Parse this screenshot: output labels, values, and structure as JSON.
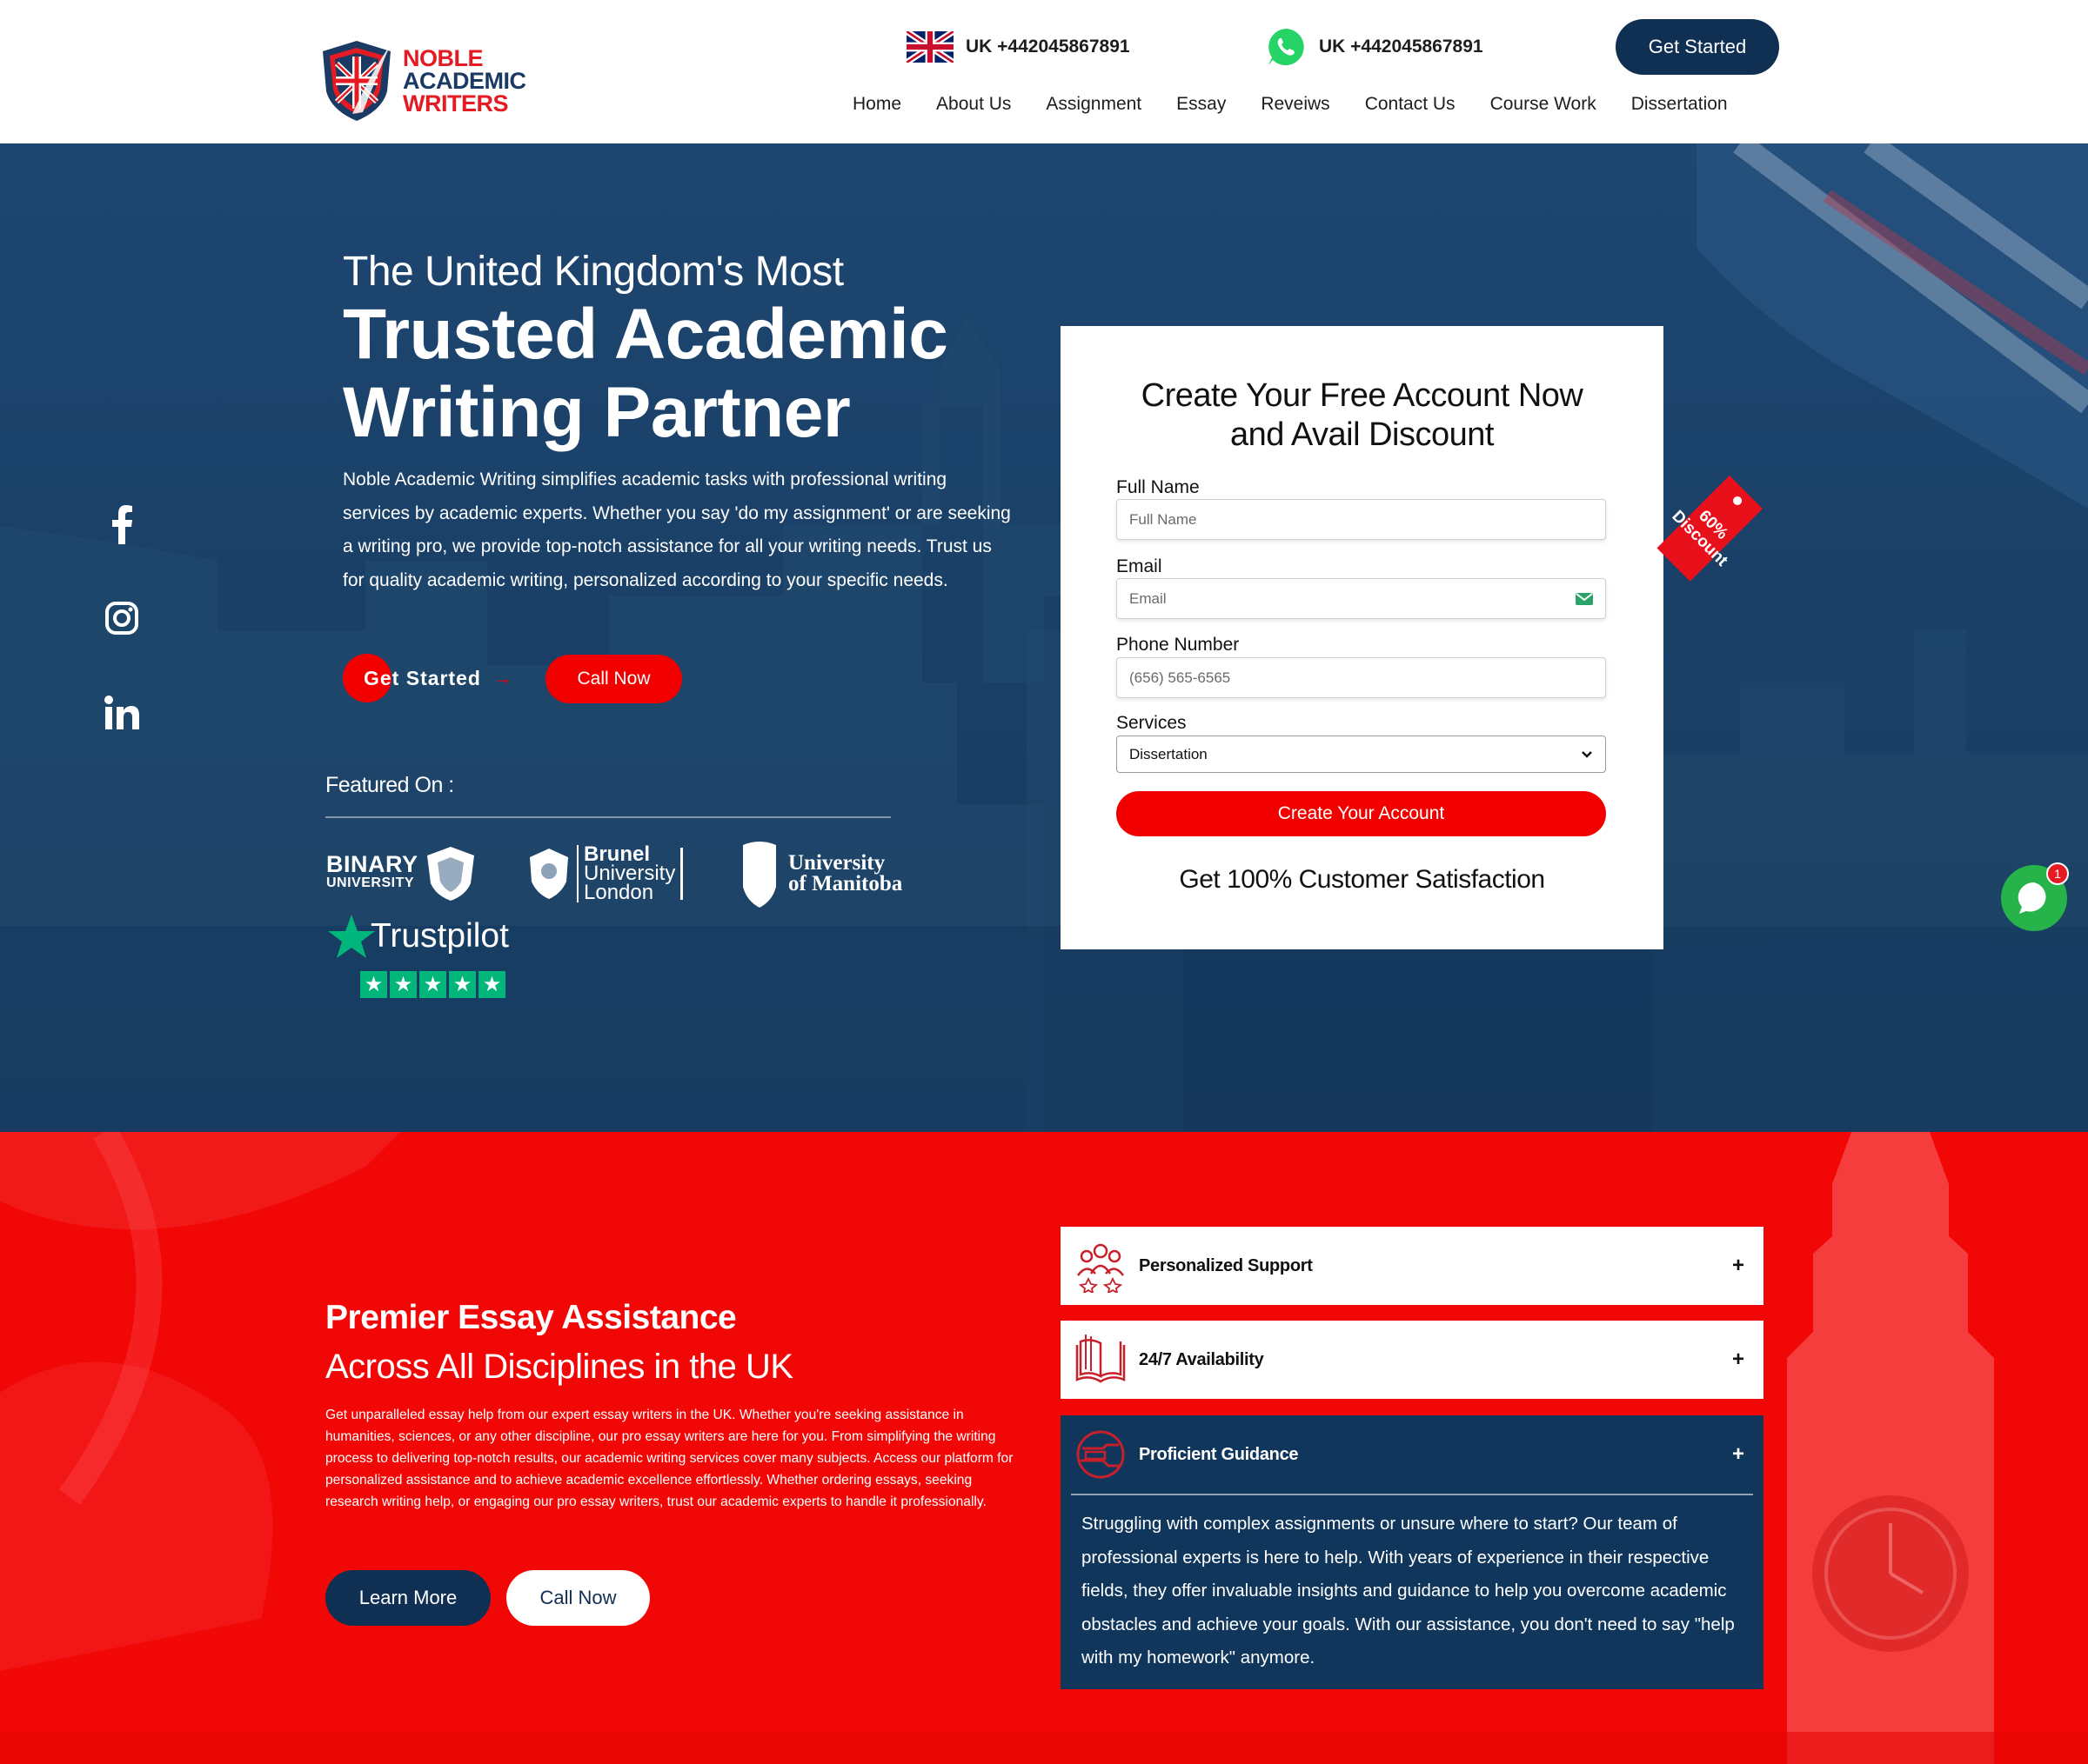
{
  "header": {
    "logo": {
      "line1": "NOBLE",
      "line2": "ACADEMIC",
      "line3": "WRITERS"
    },
    "phone1": {
      "icon": "uk-flag-icon",
      "text": "UK +442045867891"
    },
    "phone2": {
      "icon": "whatsapp-icon",
      "text": "UK +442045867891"
    },
    "cta": "Get Started",
    "nav": [
      "Home",
      "About Us",
      "Assignment",
      "Essay",
      "Reveiws",
      "Contact Us",
      "Course Work",
      "Dissertation"
    ]
  },
  "hero": {
    "subtitle": "The United Kingdom's Most",
    "title": "Trusted Academic Writing Partner",
    "description": "Noble Academic Writing simplifies academic tasks with professional writing services by academic experts. Whether you say 'do my assignment' or are seeking a writing pro, we provide top-notch assistance for all your writing needs. Trust us for quality academic writing, personalized according to your specific needs.",
    "get_started": "Get Started",
    "arrow": "→",
    "call_now": "Call Now",
    "featured_label": "Featured On :",
    "featured": {
      "binary": {
        "line1": "BINARY",
        "line2": "UNIVERSITY"
      },
      "brunel": {
        "line1": "Brunel",
        "line2": "University",
        "line3": "London"
      },
      "manitoba": {
        "line1": "University",
        "line2": "of Manitoba"
      },
      "trustpilot": "Trustpilot",
      "trustpilot_rating": 5
    },
    "social": [
      "facebook-icon",
      "instagram-icon",
      "linkedin-icon"
    ]
  },
  "form": {
    "title_line1": "Create Your Free Account Now",
    "title_line2": "and Avail Discount",
    "full_name_label": "Full Name",
    "full_name_placeholder": "Full Name",
    "email_label": "Email",
    "email_placeholder": "Email",
    "phone_label": "Phone Number",
    "phone_placeholder": "(656) 565-6565",
    "services_label": "Services",
    "services_selected": "Dissertation",
    "submit": "Create Your Account",
    "satisfaction": "Get 100% Customer Satisfaction",
    "discount_line1": "60%",
    "discount_line2": "Discount"
  },
  "chat": {
    "badge": "1"
  },
  "premier": {
    "title": "Premier Essay Assistance",
    "subtitle": "Across All Disciplines in the UK",
    "description": "Get unparalleled essay help from our expert essay writers in the UK. Whether you're seeking assistance in humanities, sciences, or any other discipline, our pro essay writers are here for you. From simplifying the writing process to delivering top-notch results, our academic writing services cover many subjects. Access our platform for personalized assistance and to achieve academic excellence effortlessly. Whether ordering essays, seeking research writing help, or engaging our pro essay writers, trust our academic experts to handle it professionally.",
    "learn_more": "Learn More",
    "call_now": "Call Now",
    "accordion": [
      {
        "icon": "team-icon",
        "label": "Personalized Support",
        "toggle": "+"
      },
      {
        "icon": "book-icon",
        "label": "24/7 Availability",
        "toggle": "+"
      },
      {
        "icon": "guidance-icon",
        "label": "Proficient Guidance",
        "toggle": "+",
        "body": "Struggling with complex assignments or unsure where to start? Our team of professional experts is here to help. With years of experience in their respective fields, they offer invaluable insights and guidance to help you overcome academic obstacles and achieve your goals. With our assistance, you don't need to say \"help with my homework\" anymore."
      }
    ]
  }
}
